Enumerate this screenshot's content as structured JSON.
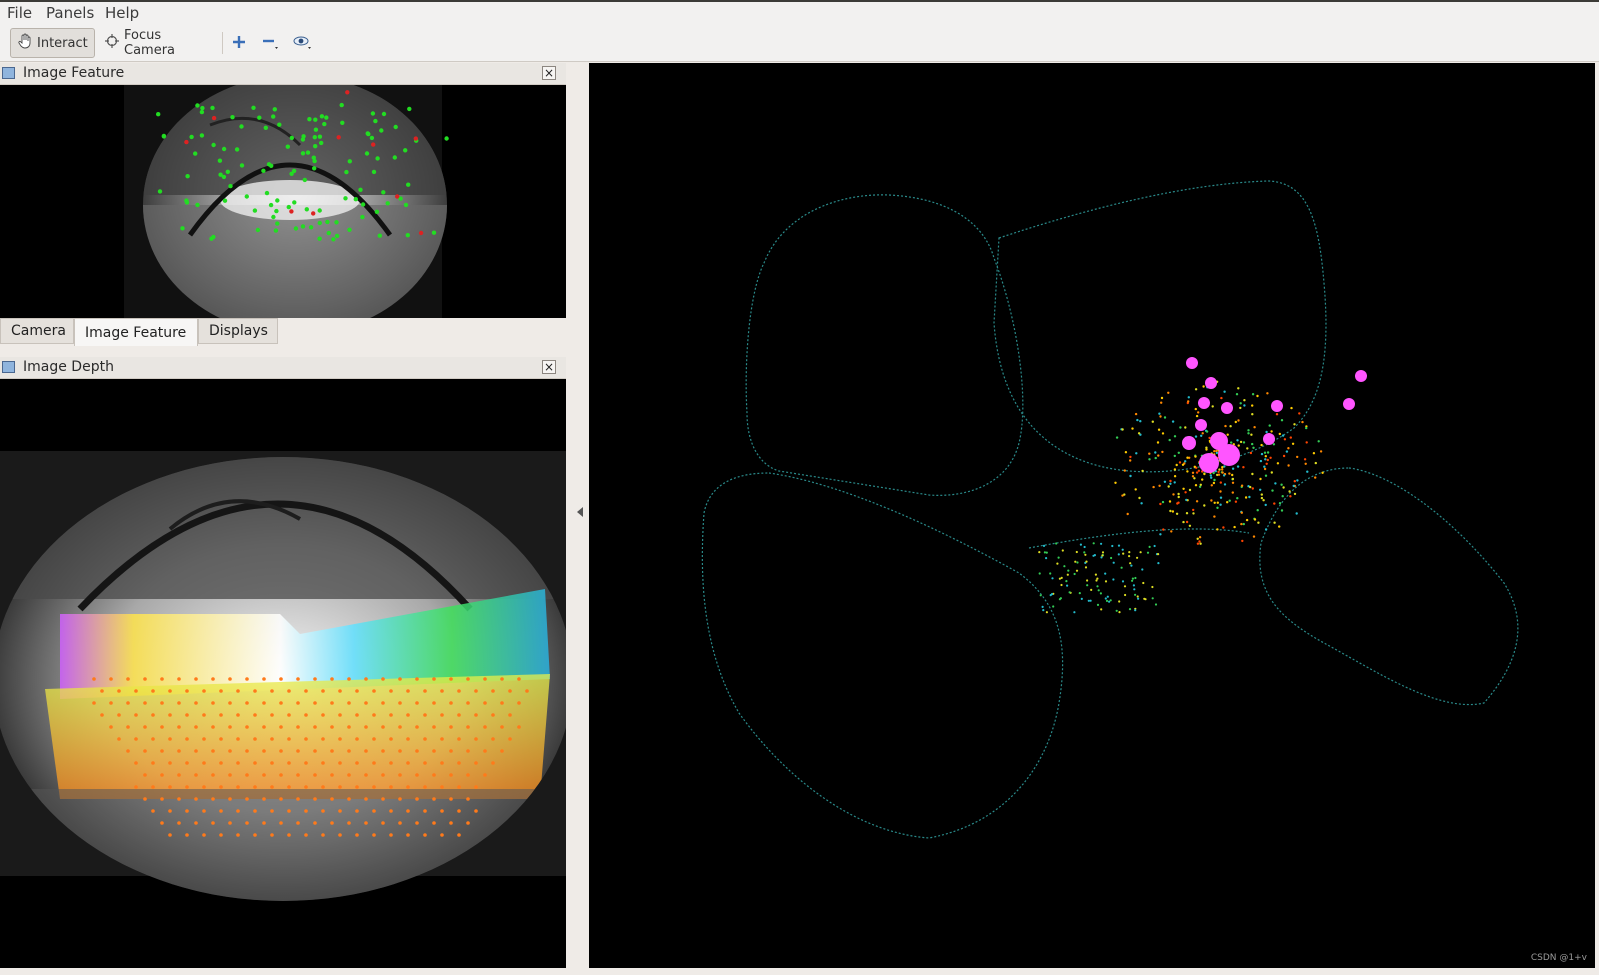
{
  "menubar": {
    "items": [
      "File",
      "Panels",
      "Help"
    ]
  },
  "toolbar": {
    "interact_label": "Interact",
    "focus_camera_label": "Focus Camera",
    "icons": [
      "hand-icon",
      "crosshair-icon",
      "plus-icon",
      "minus-icon",
      "eye-icon"
    ]
  },
  "panels": {
    "image_feature": {
      "title": "Image Feature",
      "close": "×"
    },
    "image_depth": {
      "title": "Image Depth",
      "close": "×"
    }
  },
  "tabs": [
    "Camera",
    "Image Feature",
    "Displays"
  ],
  "selected_tab": "Image Feature",
  "view3d": {
    "watermark": "CSDN @1+v"
  },
  "colors": {
    "feature_points": "#22dd22",
    "outlier_points": "#dd2222",
    "landmarks": "#ff55ff",
    "trajectory": "#2a8a8a",
    "background": "#000000"
  }
}
